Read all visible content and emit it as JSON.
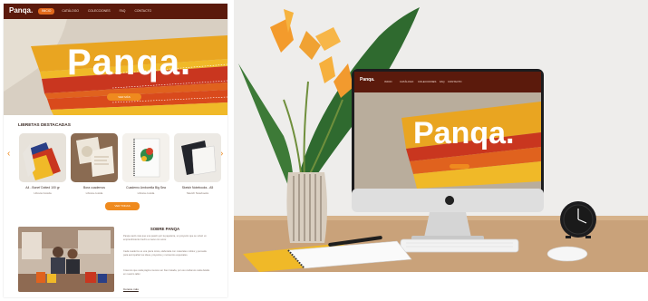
{
  "website": {
    "brand": "Panqa.",
    "nav": [
      "INICIO",
      "CATÁLOGO",
      "COLECCIONES",
      "FAQ",
      "CONTACTO"
    ],
    "hero": {
      "title": "Panqa.",
      "button": "VER MÁS"
    },
    "featured": {
      "title": "LIBRETAS DESTACADAS",
      "prev": "‹",
      "next": "›",
      "products": [
        {
          "name": "A4 - Bonef Dotted 100 gr",
          "price": "Libreta Cosida"
        },
        {
          "name": "Bora cuadernos",
          "price": "Libreta cosida"
        },
        {
          "name": "Cuaderno Amborella Big Sea",
          "price": "Libreta cosida"
        },
        {
          "name": "Sketch Notebooks - A5",
          "price": "Sketch Notebooks"
        }
      ],
      "more_button": "VER TODAS"
    },
    "about": {
      "title": "SOBRE PANQA",
      "paragraphs": [
        "Panqa nació más que una pasión por la papelería, un proyecto que se volvió un emprendimiento hecho a mano con amor.",
        "Cada cuaderno es una pieza única, elaborada con materiales nobles y pensada para acompañar tus ideas, proyectos y momentos especiales.",
        "Creemos que cada página merece ser bien tratada, por eso cuidamos cada detalle en nuestro taller."
      ],
      "link": "Conoce más"
    }
  },
  "scene": {
    "monitor": {
      "brand": "Panqa.",
      "nav": [
        "INICIO",
        "CATÁLOGO",
        "COLECCIONES",
        "FAQ",
        "CONTACTO"
      ],
      "hero_title": "Panqa."
    }
  },
  "colors": {
    "nav_brown": "#5b1a0c",
    "accent_orange": "#ef8a1e",
    "notebook_yellow": "#f0b928",
    "notebook_red": "#c9361f",
    "notebook_orange": "#e0621e"
  }
}
